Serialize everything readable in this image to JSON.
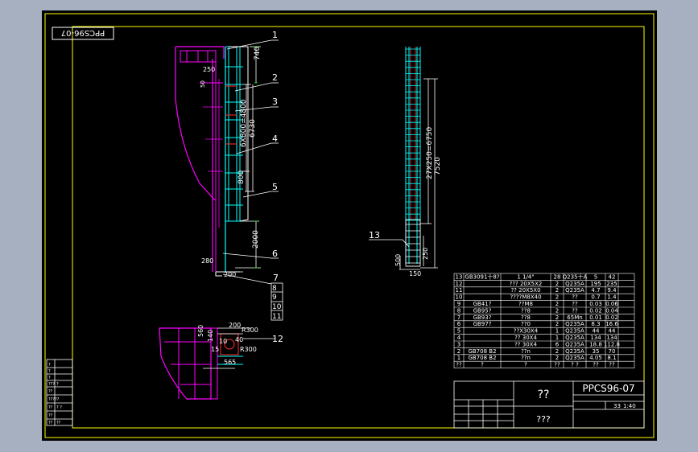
{
  "colors": {
    "background": "#a7b0c1",
    "canvas": "#000000",
    "frame": "#ffff00",
    "inner_frame": "#00ffff",
    "magenta": "#ff00ff",
    "white": "#ffffff",
    "cyan": "#00ffff",
    "red": "#ff3030",
    "green": "#00ff00"
  },
  "drawing": {
    "drawing_number": "PPCS96-07",
    "drawing_number_mirrored": "PPCS96-07",
    "title_main": "??",
    "title_sub": "???",
    "scale": "1:40",
    "sheet": "33",
    "dims": {
      "d740": "740",
      "d250": "250",
      "d50": "50",
      "d6x800": "6X800=4800",
      "d6730": "6730",
      "d800": "800",
      "d2000": "2000",
      "d280": "280",
      "d200": "200",
      "d27x250": "27X250=6750",
      "d7520": "7520",
      "d250b": "250",
      "d500": "500",
      "d150": "150",
      "d200b": "200",
      "d560": "560",
      "d140": "140",
      "r300a": "R300",
      "r300b": "R300",
      "d15": "15",
      "d10": "10",
      "d565": "565",
      "d40": "40"
    },
    "balloons": [
      "1",
      "2",
      "3",
      "4",
      "5",
      "6",
      "7",
      "8",
      "9",
      "10",
      "11",
      "12",
      "13"
    ],
    "left_block": [
      "?",
      "?",
      "?",
      "???",
      "?",
      "??",
      "?????",
      "??",
      "? ?",
      "??",
      "??",
      "??"
    ]
  },
  "bom": {
    "header": [
      "13",
      "GB3091十8?",
      "1 1/4\"",
      "28",
      "Q235十A",
      "5",
      "42"
    ],
    "rows": [
      [
        "12",
        "",
        "??? 20X5X2",
        "2",
        "Q235A",
        "195",
        "235"
      ],
      [
        "11",
        "",
        "?? 20X5X0",
        "2",
        "Q235A",
        "4.7",
        "9.4"
      ],
      [
        "10",
        "",
        "????M8X40",
        "2",
        "??",
        "0.7",
        "1.4"
      ],
      [
        "9",
        "GB41?",
        "??M8",
        "2",
        "??",
        "0.03",
        "0.06"
      ],
      [
        "8",
        "GB95?",
        "??8",
        "2",
        "??",
        "0.02",
        "0.04"
      ],
      [
        "7",
        "GB93?",
        "??8",
        "2",
        "65Mn",
        "0.01",
        "0.02"
      ],
      [
        "6",
        "GB97?",
        "??0",
        "2",
        "Q235A",
        "8.3",
        "16.6"
      ],
      [
        "5",
        "",
        "??X30X4",
        "1",
        "Q235A",
        "44",
        "44"
      ],
      [
        "4",
        "",
        "??  30X4",
        "1",
        "Q235A",
        "134",
        "134"
      ],
      [
        "3",
        "",
        "??  30X4",
        "6",
        "Q235A",
        "18.8",
        "112.8"
      ],
      [
        "2",
        "GB708 B2",
        "??n",
        "2",
        "Q235A",
        "35",
        "70"
      ],
      [
        "1",
        "GB708 B2",
        "??n",
        "2",
        "Q235A",
        "4.05",
        "8.1"
      ]
    ],
    "footer": [
      "??",
      "?",
      "?",
      "??",
      "? ?",
      "??",
      "??"
    ]
  }
}
